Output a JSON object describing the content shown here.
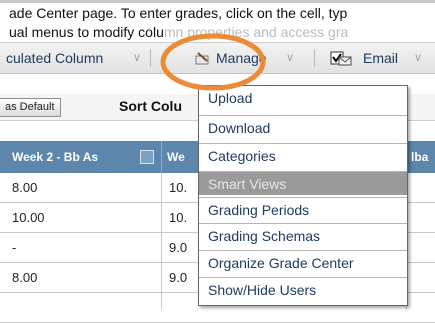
{
  "instructions": {
    "line1": "ade Center page. To enter grades, click on the cell, typ",
    "line2": "ual menus to modify colu",
    "line2_hidden": "mn properties and access gra"
  },
  "toolbar": {
    "calculated_column": "culated Column",
    "manage": "Manage",
    "email": "Email"
  },
  "sortbar": {
    "default_button": "as Default",
    "sort_label": "Sort Colu"
  },
  "grid": {
    "columns": [
      "Week 2 - Bb As",
      "We",
      "lba"
    ],
    "rows": [
      [
        "8.00",
        "10.",
        ""
      ],
      [
        "10.00",
        "10.",
        ""
      ],
      [
        "-",
        "9.0",
        ""
      ],
      [
        "8.00",
        "9.0",
        ""
      ]
    ]
  },
  "manage_menu": {
    "items": [
      {
        "label": "Upload",
        "enabled": true
      },
      {
        "label": "Download",
        "enabled": true
      },
      {
        "label": "Categories",
        "enabled": true
      },
      {
        "label": "Smart Views",
        "enabled": false
      },
      {
        "label": "Grading Periods",
        "enabled": true
      },
      {
        "label": "Grading Schemas",
        "enabled": true
      },
      {
        "label": "Organize Grade Center",
        "enabled": true
      },
      {
        "label": "Show/Hide Users",
        "enabled": true
      }
    ]
  },
  "icons": [
    "chevron-down-icon",
    "manage-pencil-icon",
    "email-icon",
    "column-menu-icon"
  ],
  "colors": {
    "header_blue": "#5d86ad",
    "highlight_orange": "#ec8a36",
    "disabled_item": "#9a9a9a",
    "link_text": "#1f3b61"
  }
}
